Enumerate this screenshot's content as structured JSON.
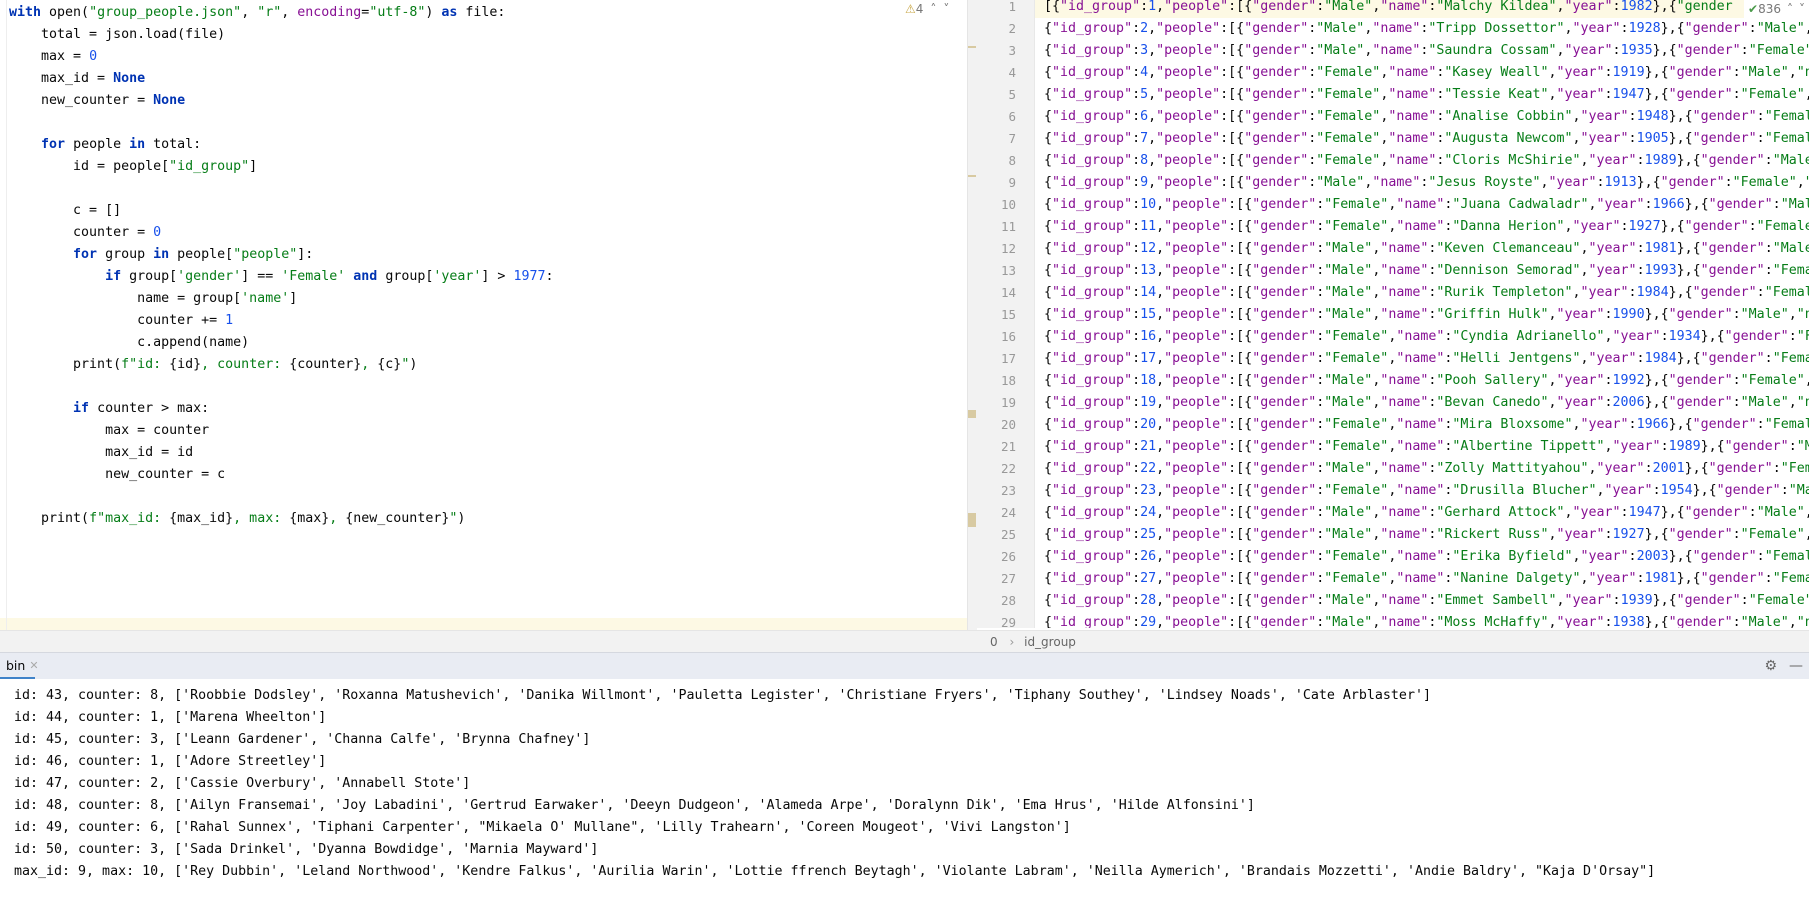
{
  "left_editor": {
    "inspection_count": "4",
    "lines": [
      [
        [
          "k",
          "with"
        ],
        [
          "t",
          " open("
        ],
        [
          "s",
          "\"group_people.json\""
        ],
        [
          "t",
          ", "
        ],
        [
          "s",
          "\"r\""
        ],
        [
          "t",
          ", "
        ],
        [
          "p",
          "encoding"
        ],
        [
          "t",
          "="
        ],
        [
          "s",
          "\"utf-8\""
        ],
        [
          "t",
          ") "
        ],
        [
          "k",
          "as"
        ],
        [
          "t",
          " file:"
        ]
      ],
      [
        [
          "t",
          "    total = json.load(file)"
        ]
      ],
      [
        [
          "t",
          "    max = "
        ],
        [
          "n",
          "0"
        ]
      ],
      [
        [
          "t",
          "    max_id = "
        ],
        [
          "k",
          "None"
        ]
      ],
      [
        [
          "t",
          "    new_counter = "
        ],
        [
          "k",
          "None"
        ]
      ],
      [],
      [
        [
          "t",
          "    "
        ],
        [
          "k",
          "for"
        ],
        [
          "t",
          " people "
        ],
        [
          "k",
          "in"
        ],
        [
          "t",
          " total:"
        ]
      ],
      [
        [
          "t",
          "        id = people["
        ],
        [
          "s",
          "\"id_group\""
        ],
        [
          "t",
          "]"
        ]
      ],
      [],
      [
        [
          "t",
          "        c = []"
        ]
      ],
      [
        [
          "t",
          "        counter = "
        ],
        [
          "n",
          "0"
        ]
      ],
      [
        [
          "t",
          "        "
        ],
        [
          "k",
          "for"
        ],
        [
          "t",
          " group "
        ],
        [
          "k",
          "in"
        ],
        [
          "t",
          " people["
        ],
        [
          "s",
          "\"people\""
        ],
        [
          "t",
          "]:"
        ]
      ],
      [
        [
          "t",
          "            "
        ],
        [
          "k",
          "if"
        ],
        [
          "t",
          " group["
        ],
        [
          "s",
          "'gender'"
        ],
        [
          "t",
          "] == "
        ],
        [
          "s",
          "'Female'"
        ],
        [
          "t",
          " "
        ],
        [
          "k",
          "and"
        ],
        [
          "t",
          " group["
        ],
        [
          "s",
          "'year'"
        ],
        [
          "t",
          "] > "
        ],
        [
          "n",
          "1977"
        ],
        [
          "t",
          ":"
        ]
      ],
      [
        [
          "t",
          "                name = group["
        ],
        [
          "s",
          "'name'"
        ],
        [
          "t",
          "]"
        ]
      ],
      [
        [
          "t",
          "                counter += "
        ],
        [
          "n",
          "1"
        ]
      ],
      [
        [
          "t",
          "                c.append(name)"
        ]
      ],
      [
        [
          "t",
          "        print("
        ],
        [
          "s",
          "f\"id: "
        ],
        [
          "t",
          "{id}"
        ],
        [
          "s",
          ", counter: "
        ],
        [
          "t",
          "{counter}"
        ],
        [
          "s",
          ", "
        ],
        [
          "t",
          "{c}"
        ],
        [
          "s",
          "\""
        ],
        [
          "t",
          ")"
        ]
      ],
      [],
      [
        [
          "t",
          "        "
        ],
        [
          "k",
          "if"
        ],
        [
          "t",
          " counter > max:"
        ]
      ],
      [
        [
          "t",
          "            max = counter"
        ]
      ],
      [
        [
          "t",
          "            max_id = id"
        ]
      ],
      [
        [
          "t",
          "            new_counter = c"
        ]
      ],
      [],
      [
        [
          "t",
          "    print("
        ],
        [
          "s",
          "f\"max_id: "
        ],
        [
          "t",
          "{max_id}"
        ],
        [
          "s",
          ", max: "
        ],
        [
          "t",
          "{max}"
        ],
        [
          "s",
          ", "
        ],
        [
          "t",
          "{new_counter}"
        ],
        [
          "s",
          "\""
        ],
        [
          "t",
          ")"
        ]
      ]
    ]
  },
  "right_editor": {
    "inspection_count": "836",
    "lines": [
      "[{\"id_group\":1,\"people\":[{\"gender\":\"Male\",\"name\":\"Malchy Kildea\",\"year\":1982},{\"gender",
      "{\"id_group\":2,\"people\":[{\"gender\":\"Male\",\"name\":\"Tripp Dossettor\",\"year\":1928},{\"gender\":\"Male\",",
      "{\"id_group\":3,\"people\":[{\"gender\":\"Male\",\"name\":\"Saundra Cossam\",\"year\":1935},{\"gender\":\"Female\"",
      "{\"id_group\":4,\"people\":[{\"gender\":\"Female\",\"name\":\"Kasey Weall\",\"year\":1919},{\"gender\":\"Male\",\"n",
      "{\"id_group\":5,\"people\":[{\"gender\":\"Female\",\"name\":\"Tessie Keat\",\"year\":1947},{\"gender\":\"Female\",",
      "{\"id_group\":6,\"people\":[{\"gender\":\"Female\",\"name\":\"Analise Cobbin\",\"year\":1948},{\"gender\":\"Femal",
      "{\"id_group\":7,\"people\":[{\"gender\":\"Female\",\"name\":\"Augusta Newcom\",\"year\":1905},{\"gender\":\"Femal",
      "{\"id_group\":8,\"people\":[{\"gender\":\"Female\",\"name\":\"Cloris McShirie\",\"year\":1989},{\"gender\":\"Male",
      "{\"id_group\":9,\"people\":[{\"gender\":\"Male\",\"name\":\"Jesus Royste\",\"year\":1913},{\"gender\":\"Female\",\"",
      "{\"id_group\":10,\"people\":[{\"gender\":\"Female\",\"name\":\"Juana Cadwaladr\",\"year\":1966},{\"gender\":\"Mal",
      "{\"id_group\":11,\"people\":[{\"gender\":\"Female\",\"name\":\"Danna Herion\",\"year\":1927},{\"gender\":\"Female",
      "{\"id_group\":12,\"people\":[{\"gender\":\"Male\",\"name\":\"Keven Clemanceau\",\"year\":1981},{\"gender\":\"Male",
      "{\"id_group\":13,\"people\":[{\"gender\":\"Male\",\"name\":\"Dennison Semorad\",\"year\":1993},{\"gender\":\"Fema",
      "{\"id_group\":14,\"people\":[{\"gender\":\"Male\",\"name\":\"Rurik Templeton\",\"year\":1984},{\"gender\":\"Femal",
      "{\"id_group\":15,\"people\":[{\"gender\":\"Male\",\"name\":\"Griffin Hulk\",\"year\":1990},{\"gender\":\"Male\",\"n",
      "{\"id_group\":16,\"people\":[{\"gender\":\"Female\",\"name\":\"Cyndia Adrianello\",\"year\":1934},{\"gender\":\"F",
      "{\"id_group\":17,\"people\":[{\"gender\":\"Female\",\"name\":\"Helli Jentgens\",\"year\":1984},{\"gender\":\"Fema",
      "{\"id_group\":18,\"people\":[{\"gender\":\"Male\",\"name\":\"Pooh Sallery\",\"year\":1992},{\"gender\":\"Female\",",
      "{\"id_group\":19,\"people\":[{\"gender\":\"Male\",\"name\":\"Bevan Canedo\",\"year\":2006},{\"gender\":\"Male\",\"n",
      "{\"id_group\":20,\"people\":[{\"gender\":\"Female\",\"name\":\"Mira Bloxsome\",\"year\":1966},{\"gender\":\"Femal",
      "{\"id_group\":21,\"people\":[{\"gender\":\"Female\",\"name\":\"Albertine Tippett\",\"year\":1989},{\"gender\":\"M",
      "{\"id_group\":22,\"people\":[{\"gender\":\"Male\",\"name\":\"Zolly Mattityahou\",\"year\":2001},{\"gender\":\"Fem",
      "{\"id_group\":23,\"people\":[{\"gender\":\"Female\",\"name\":\"Drusilla Blucher\",\"year\":1954},{\"gender\":\"Ma",
      "{\"id_group\":24,\"people\":[{\"gender\":\"Male\",\"name\":\"Gerhard Attock\",\"year\":1947},{\"gender\":\"Male\",",
      "{\"id_group\":25,\"people\":[{\"gender\":\"Male\",\"name\":\"Rickert Russ\",\"year\":1927},{\"gender\":\"Female\",",
      "{\"id_group\":26,\"people\":[{\"gender\":\"Female\",\"name\":\"Erika Byfield\",\"year\":2003},{\"gender\":\"Femal",
      "{\"id_group\":27,\"people\":[{\"gender\":\"Female\",\"name\":\"Nanine Dalgety\",\"year\":1981},{\"gender\":\"Fema",
      "{\"id_group\":28,\"people\":[{\"gender\":\"Male\",\"name\":\"Emmet Sambell\",\"year\":1939},{\"gender\":\"Female\"",
      "{\"id_group\":29,\"people\":[{\"gender\":\"Male\",\"name\":\"Moss McHaffy\",\"year\":1938},{\"gender\":\"Male\",\"n"
    ],
    "breadcrumb": [
      "0",
      "id_group"
    ]
  },
  "tool_window": {
    "tab_label": "bin",
    "console_lines": [
      "id: 43, counter: 8, ['Roobbie Dodsley', 'Roxanna Matushevich', 'Danika Willmont', 'Pauletta Legister', 'Christiane Fryers', 'Tiphany Southey', 'Lindsey Noads', 'Cate Arblaster']",
      "id: 44, counter: 1, ['Marena Wheelton']",
      "id: 45, counter: 3, ['Leann Gardener', 'Channa Calfe', 'Brynna Chafney']",
      "id: 46, counter: 1, ['Adore Streetley']",
      "id: 47, counter: 2, ['Cassie Overbury', 'Annabell Stote']",
      "id: 48, counter: 8, ['Ailyn Fransemai', 'Joy Labadini', 'Gertrud Earwaker', 'Deeyn Dudgeon', 'Alameda Arpe', 'Doralynn Dik', 'Ema Hrus', 'Hilde Alfonsini']",
      "id: 49, counter: 6, ['Rahal Sunnex', 'Tiphani Carpenter', \"Mikaela O' Mullane\", 'Lilly Trahearn', 'Coreen Mougeot', 'Vivi Langston']",
      "id: 50, counter: 3, ['Sada Drinkel', 'Dyanna Bowdidge', 'Marnia Mayward']",
      "max_id: 9, max: 10, ['Rey Dubbin', 'Leland Northwood', 'Kendre Falkus', 'Aurilia Warin', 'Lottie ffrench Beytagh', 'Violante Labram', 'Neilla Aymerich', 'Brandais Mozzetti', 'Andie Baldry', \"Kaja D'Orsay\"]"
    ]
  },
  "icons": {
    "warning": "warning-icon",
    "ok": "check-icon",
    "settings": "gear-icon",
    "hide": "minimize-icon"
  },
  "colors": {
    "keyword": "#0033b3",
    "string": "#067d17",
    "number": "#1750eb",
    "json_key": "#871094",
    "current_line": "#fdf9e4",
    "tab_underline": "#4083c9"
  }
}
